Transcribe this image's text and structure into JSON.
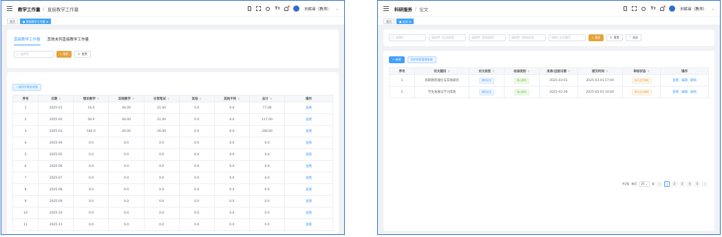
{
  "left": {
    "breadcrumb": {
      "parent": "教学工作量",
      "current": "直接教学工作量"
    },
    "user": "刘辉审（教师）",
    "tags": {
      "home": "首页",
      "active": "● 直接教学工作量 ⊗"
    },
    "tabs": [
      "直接教学工作量",
      "其他未列直接教学工作量"
    ],
    "filters": {
      "month_placeholder": "选择月",
      "search": "搜索",
      "reset": "重置"
    },
    "action_button": "一键同步教务系统",
    "table": {
      "headers": [
        "序号",
        "日期",
        "理论教学",
        "实践教学",
        "日常笔试",
        "其他",
        "其他不列",
        "总计",
        "操作"
      ],
      "rows": [
        [
          "1",
          "2025-01",
          "16.0",
          "40.00",
          "21.00",
          "0.0",
          "0.0",
          "77.00",
          "查看"
        ],
        [
          "2",
          "2025-02",
          "56.0",
          "40.00",
          "21.00",
          "0.0",
          "0.0",
          "117.00",
          "查看"
        ],
        [
          "3",
          "2025-03",
          "182.0",
          "40.00",
          "26.00",
          "0.0",
          "0.0",
          "248.00",
          "查看"
        ],
        [
          "4",
          "2025-04",
          "0.0",
          "0.0",
          "0.0",
          "0.0",
          "0.0",
          "0.0",
          "查看"
        ],
        [
          "5",
          "2025-05",
          "0.0",
          "0.0",
          "0.0",
          "0.0",
          "0.0",
          "0.0",
          "查看"
        ],
        [
          "6",
          "2025-06",
          "0.0",
          "0.0",
          "0.0",
          "0.0",
          "0.0",
          "0.0",
          "查看"
        ],
        [
          "7",
          "2025-07",
          "0.0",
          "0.0",
          "0.0",
          "0.0",
          "0.0",
          "0.0",
          "查看"
        ],
        [
          "8",
          "2025-08",
          "0.0",
          "0.0",
          "0.0",
          "0.0",
          "0.0",
          "0.0",
          "查看"
        ],
        [
          "9",
          "2025-09",
          "0.0",
          "0.0",
          "0.0",
          "0.0",
          "0.0",
          "0.0",
          "查看"
        ],
        [
          "10",
          "2025-10",
          "0.0",
          "0.0",
          "0.0",
          "0.0",
          "0.0",
          "0.0",
          "查看"
        ],
        [
          "11",
          "2025-11",
          "0.0",
          "0.0",
          "0.0",
          "0.0",
          "0.0",
          "0.0",
          "查看"
        ]
      ]
    }
  },
  "right": {
    "breadcrumb": {
      "parent": "科研服务",
      "current": "论文"
    },
    "user": "刘辉审（教师）",
    "tags": {
      "home": "首页",
      "active": "● 论文 ⊗"
    },
    "filters": {
      "year_placeholder": "选择年",
      "type1": "请选择（论文类型）",
      "type2": "请选择（收录类别）",
      "type3": "请选择（审核状态）",
      "keyword": "请输入论文题目",
      "search": "搜索",
      "reset": "重置",
      "collapse": "收起"
    },
    "add_button": "+ 新增",
    "sync_button": "同步科研管理系统",
    "table": {
      "headers": [
        "序号",
        "论文题目",
        "论文类型",
        "收录类别",
        "发表/出版日期",
        "提交时间",
        "审核状态",
        "操作"
      ],
      "rows": [
        {
          "no": "1",
          "title": "高职教育理论与实践研究",
          "type": "期刊论文",
          "category": "核心期刊",
          "date": "2025-03-01",
          "submitted": "2025-03-01 17:00",
          "status": "待办正在审核",
          "actions": [
            "查看",
            "编辑",
            "删除"
          ]
        },
        {
          "no": "2",
          "title": "学生发展与学习成效",
          "type": "期刊论文",
          "category": "核心期刊",
          "date": "2025-02-28",
          "submitted": "2025-03-01 10:00",
          "status": "待办正在审核",
          "actions": [
            "查看",
            "编辑",
            "删除"
          ]
        }
      ]
    },
    "pager": {
      "total": "共2条",
      "per_page_label": "每页",
      "per_page": "20",
      "unit": "条",
      "pages": [
        "1",
        "2",
        "3",
        "4",
        "5"
      ],
      "active_page": "1"
    }
  }
}
